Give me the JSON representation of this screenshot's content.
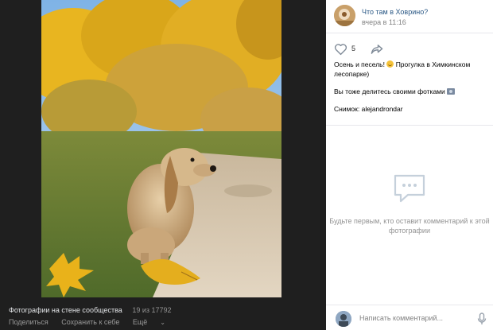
{
  "photo_footer": {
    "album_title": "Фотографии на стене сообщества",
    "counter": "19 из 17792",
    "share_label": "Поделиться",
    "save_label": "Сохранить к себе",
    "more_label": "Ещё",
    "more_chevron": "⌄"
  },
  "author": {
    "name": "Что там в Ховрино?",
    "date": "вчера в 11:16"
  },
  "actions": {
    "like_count": "5"
  },
  "description": {
    "line1_before_emoji": "Осень и песель! ",
    "line1_after_emoji": " Прогулка в Химкинском лесопарке)",
    "line2_text": "Вы тоже делитесь своими фотками ",
    "line3_text": "Снимок: alejandrondar"
  },
  "comments": {
    "empty_text": "Будьте первым, кто оставит комментарий к этой фотографии"
  },
  "composer": {
    "placeholder": "Написать комментарий..."
  },
  "colors": {
    "link": "#2a5885",
    "muted": "#939393",
    "dark_panel": "#1f1f1f"
  },
  "icons": {
    "like": "heart-outline-icon",
    "share": "share-arrow-icon",
    "comment": "comment-bubble-icon",
    "mic": "microphone-icon"
  }
}
